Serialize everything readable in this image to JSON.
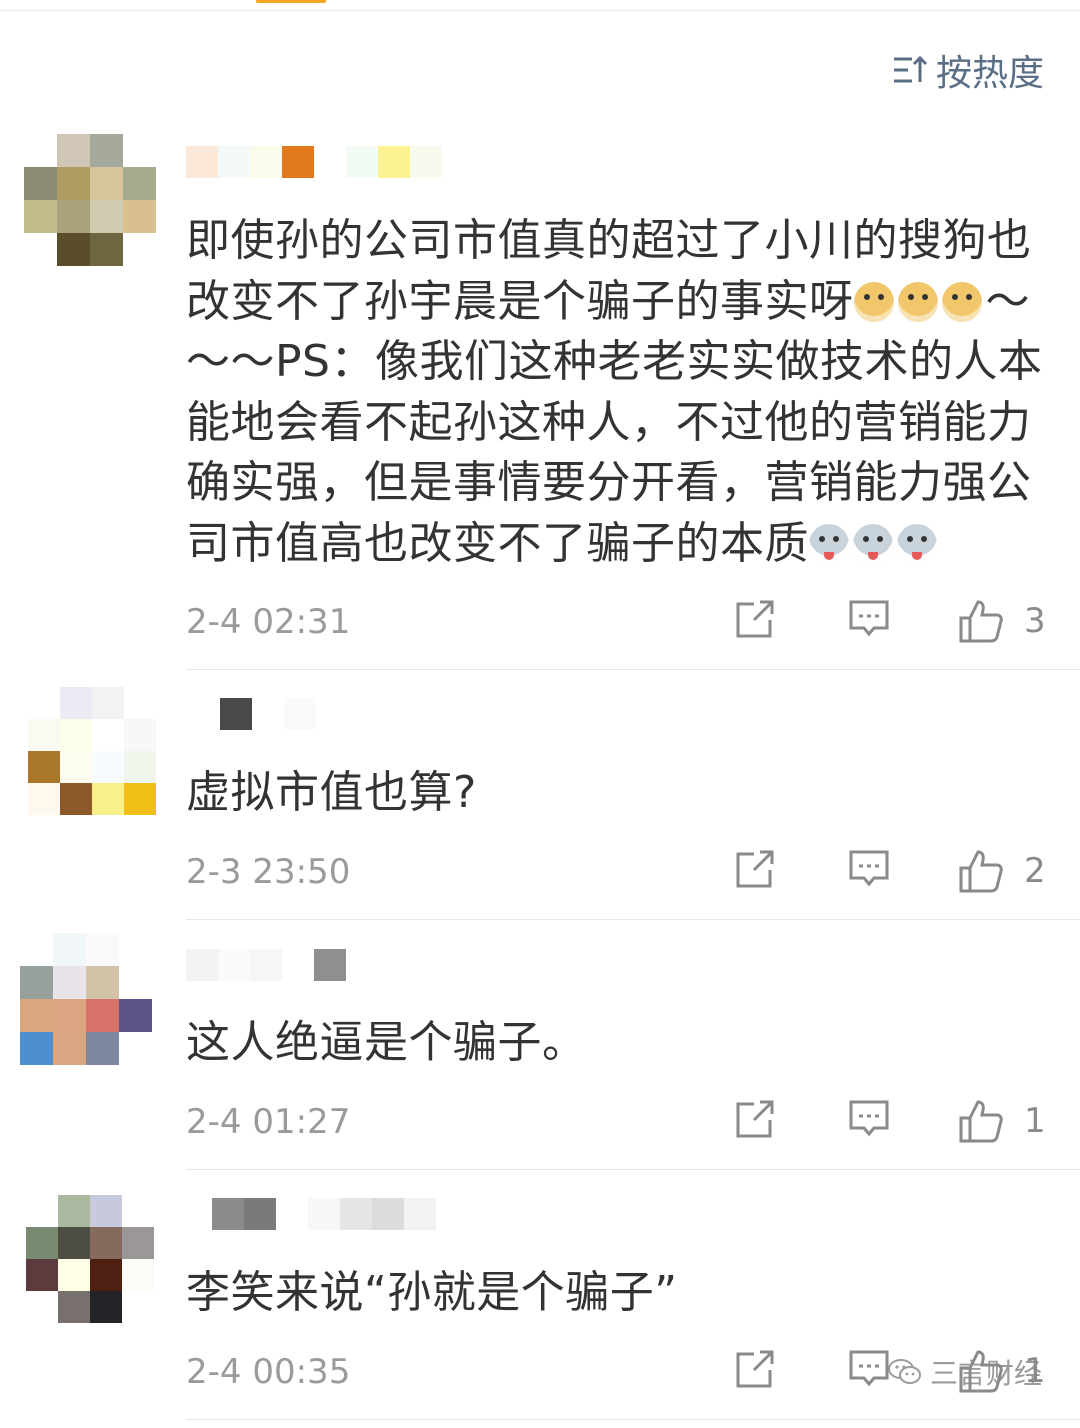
{
  "sort": {
    "label": "按热度",
    "icon": "sort-icon"
  },
  "comments": [
    {
      "text": "即使孙的公司市值真的超过了小川的搜狗也改变不了孙宇晨是个骗子的事实呀",
      "text_tail_1": "～～～PS：像我们这种老老实实做技术的人本能地会看不起孙这种人，不过他的营销能力确实强，但是事情要分开看，营销能力强公司市值高也改变不了骗子的本质",
      "time": "2-4 02:31",
      "likes": "3"
    },
    {
      "text": "虚拟市值也算?",
      "time": "2-3 23:50",
      "likes": "2"
    },
    {
      "text": "这人绝逼是个骗子。",
      "time": "2-4 01:27",
      "likes": "1"
    },
    {
      "text": "李笑来说“孙就是个骗子”",
      "time": "2-4 00:35",
      "likes": "1"
    }
  ],
  "watermark": {
    "label": "三言财经",
    "icon": "wechat-icon"
  },
  "colors": {
    "link": "#5a6f86",
    "meta": "#9a9a9a",
    "text": "#333333",
    "divider": "#e6e6e6"
  }
}
